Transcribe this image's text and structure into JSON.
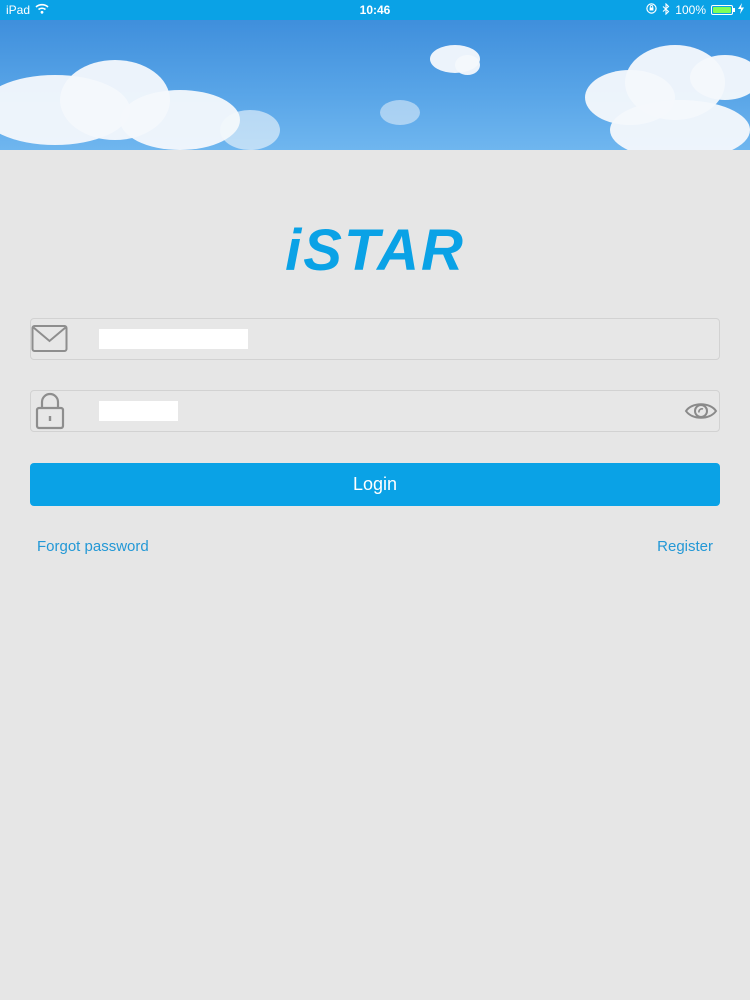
{
  "status_bar": {
    "device": "iPad",
    "time": "10:46",
    "battery": "100%",
    "battery_level": 1.0,
    "icons": [
      "wifi-icon",
      "orientation-lock-icon",
      "bluetooth-icon",
      "battery-icon",
      "charging-icon"
    ]
  },
  "app": {
    "logo_text": "iSTAR"
  },
  "login_form": {
    "email_icon": "envelope-icon",
    "email_value": "",
    "password_icon": "lock-icon",
    "password_value": "",
    "show_password_icon": "eye-icon",
    "login_label": "Login",
    "forgot_password_label": "Forgot password",
    "register_label": "Register"
  },
  "colors": {
    "accent": "#0aa2e6",
    "background": "#e6e6e6",
    "link": "#2398d6"
  }
}
